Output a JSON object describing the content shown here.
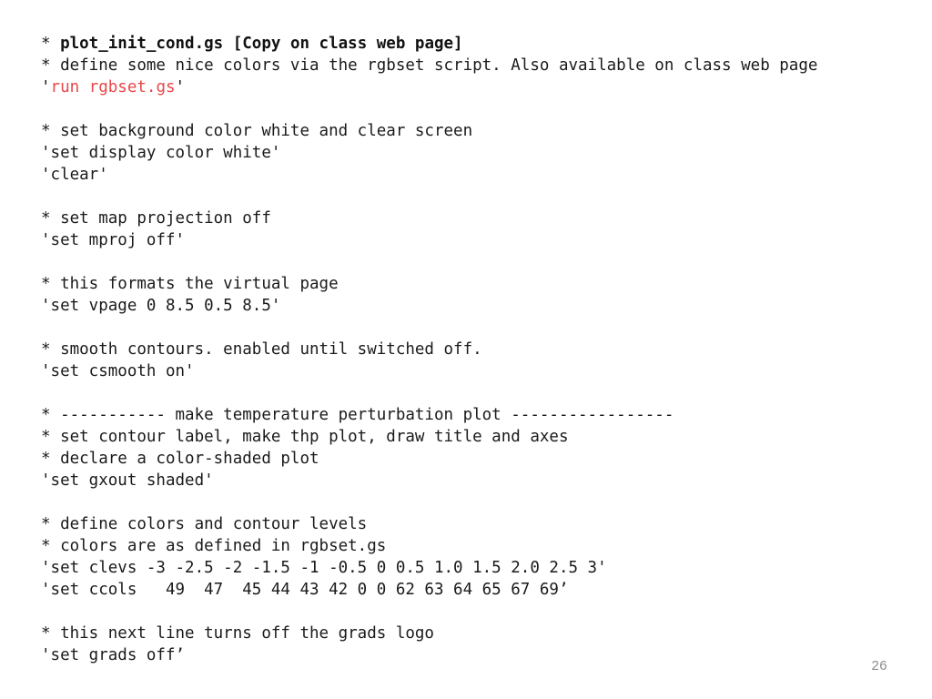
{
  "slide": {
    "page_number": "26",
    "background_color": "#ffffff",
    "text_color": "#1a1a1a",
    "accent_color": "#e8474a"
  },
  "code": {
    "language": "GrADS script",
    "lines": [
      {
        "id": "line-title",
        "type": "comment-title",
        "segments": [
          {
            "style": "plain",
            "text": "* "
          },
          {
            "style": "bold",
            "text": "plot_init_cond.gs [Copy on class web page]"
          }
        ]
      },
      {
        "id": "line-define-colors-comment",
        "type": "comment",
        "segments": [
          {
            "style": "plain",
            "text": "* define some nice colors via the rgbset script. Also available on class web page"
          }
        ]
      },
      {
        "id": "line-run-rgbset",
        "type": "command",
        "segments": [
          {
            "style": "plain",
            "text": "'"
          },
          {
            "style": "red",
            "text": "run rgbset.gs"
          },
          {
            "style": "plain",
            "text": "'"
          }
        ]
      },
      {
        "id": "blank-1",
        "type": "blank",
        "segments": []
      },
      {
        "id": "line-background-comment",
        "type": "comment",
        "segments": [
          {
            "style": "plain",
            "text": "* set background color white and clear screen"
          }
        ]
      },
      {
        "id": "line-set-display",
        "type": "command",
        "segments": [
          {
            "style": "plain",
            "text": "'set display color white'"
          }
        ]
      },
      {
        "id": "line-clear",
        "type": "command",
        "segments": [
          {
            "style": "plain",
            "text": "'clear'"
          }
        ]
      },
      {
        "id": "blank-2",
        "type": "blank",
        "segments": []
      },
      {
        "id": "line-mproj-comment",
        "type": "comment",
        "segments": [
          {
            "style": "plain",
            "text": "* set map projection off"
          }
        ]
      },
      {
        "id": "line-set-mproj",
        "type": "command",
        "segments": [
          {
            "style": "plain",
            "text": "'set mproj off'"
          }
        ]
      },
      {
        "id": "blank-3",
        "type": "blank",
        "segments": []
      },
      {
        "id": "line-vpage-comment",
        "type": "comment",
        "segments": [
          {
            "style": "plain",
            "text": "* this formats the virtual page"
          }
        ]
      },
      {
        "id": "line-set-vpage",
        "type": "command",
        "segments": [
          {
            "style": "plain",
            "text": "'set vpage 0 8.5 0.5 8.5'"
          }
        ]
      },
      {
        "id": "blank-4",
        "type": "blank",
        "segments": []
      },
      {
        "id": "line-csmooth-comment",
        "type": "comment",
        "segments": [
          {
            "style": "plain",
            "text": "* smooth contours. enabled until switched off."
          }
        ]
      },
      {
        "id": "line-set-csmooth",
        "type": "command",
        "segments": [
          {
            "style": "plain",
            "text": "'set csmooth on'"
          }
        ]
      },
      {
        "id": "blank-5",
        "type": "blank",
        "segments": []
      },
      {
        "id": "line-separator",
        "type": "comment",
        "segments": [
          {
            "style": "plain",
            "text": "* ----------- make temperature perturbation plot -----------------"
          }
        ]
      },
      {
        "id": "line-contour-label-comment",
        "type": "comment",
        "segments": [
          {
            "style": "plain",
            "text": "* set contour label, make thp plot, draw title and axes"
          }
        ]
      },
      {
        "id": "line-declare-comment",
        "type": "comment",
        "segments": [
          {
            "style": "plain",
            "text": "* declare a color-shaded plot"
          }
        ]
      },
      {
        "id": "line-set-gxout",
        "type": "command",
        "segments": [
          {
            "style": "plain",
            "text": "'set gxout shaded'"
          }
        ]
      },
      {
        "id": "blank-6",
        "type": "blank",
        "segments": []
      },
      {
        "id": "line-define-levels-comment",
        "type": "comment",
        "segments": [
          {
            "style": "plain",
            "text": "* define colors and contour levels"
          }
        ]
      },
      {
        "id": "line-rgbset-comment",
        "type": "comment",
        "segments": [
          {
            "style": "plain",
            "text": "* colors are as defined in rgbset.gs"
          }
        ]
      },
      {
        "id": "line-set-clevs",
        "type": "command",
        "segments": [
          {
            "style": "plain",
            "text": "'set clevs -3 -2.5 -2 -1.5 -1 -0.5 0 0.5 1.0 1.5 2.0 2.5 3'"
          }
        ]
      },
      {
        "id": "line-set-ccols",
        "type": "command",
        "segments": [
          {
            "style": "plain",
            "text": "'set ccols   49  47  45 44 43 42 0 0 62 63 64 65 67 69’"
          }
        ]
      },
      {
        "id": "blank-7",
        "type": "blank",
        "segments": []
      },
      {
        "id": "line-logo-comment",
        "type": "comment",
        "segments": [
          {
            "style": "plain",
            "text": "* this next line turns off the grads logo"
          }
        ]
      },
      {
        "id": "line-set-grads-off",
        "type": "command",
        "segments": [
          {
            "style": "plain",
            "text": "'set grads off’"
          }
        ]
      }
    ],
    "contour_levels": [
      "-3",
      "-2.5",
      "-2",
      "-1.5",
      "-1",
      "-0.5",
      "0",
      "0.5",
      "1.0",
      "1.5",
      "2.0",
      "2.5",
      "3"
    ],
    "contour_colors": [
      "49",
      "47",
      "45",
      "44",
      "43",
      "42",
      "0",
      "0",
      "62",
      "63",
      "64",
      "65",
      "67",
      "69"
    ]
  }
}
